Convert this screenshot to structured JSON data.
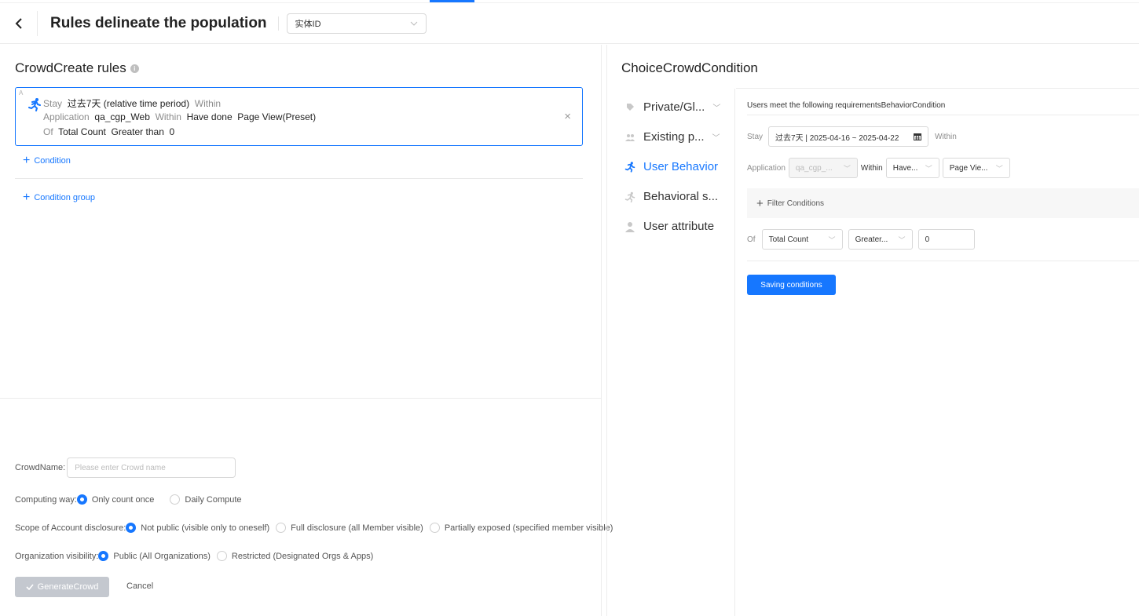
{
  "header": {
    "title": "Rules delineate the population",
    "entity_select": "实体ID"
  },
  "left": {
    "section_title": "CrowdCreate rules",
    "rule": {
      "corner_mark": "A",
      "line1_stay": "Stay",
      "line1_period": "过去7天 (relative time period)",
      "line1_within": "Within",
      "line2_application": "Application",
      "line2_app": "qa_cgp_Web",
      "line2_within": "Within",
      "line2_done": "Have done",
      "line2_event": "Page View(Preset)",
      "line3_of": "Of",
      "line3_metric": "Total Count",
      "line3_op": "Greater than",
      "line3_value": "0",
      "close": "×"
    },
    "add_condition": "Condition",
    "add_condition_group": "Condition group"
  },
  "footer": {
    "crowd_name_label": "CrowdName:",
    "crowd_name_placeholder": "Please enter Crowd name",
    "computing_label": "Computing way:",
    "computing_opt1": "Only count once",
    "computing_opt2": "Daily Compute",
    "scope_label": "Scope of Account disclosure:",
    "scope_opt1": "Not public (visible only to oneself)",
    "scope_opt2": "Full disclosure (all Member visible)",
    "scope_opt3": "Partially exposed (specified member visible)",
    "org_label": "Organization visibility:",
    "org_opt1": "Public (All Organizations)",
    "org_opt2": "Restricted (Designated Orgs & Apps)",
    "generate_label": "GenerateCrowd",
    "cancel_label": "Cancel"
  },
  "right": {
    "title": "ChoiceCrowdCondition",
    "categories": [
      {
        "label": "Private/Gl...",
        "icon": "tag-icon"
      },
      {
        "label": "Existing p...",
        "icon": "people-icon"
      },
      {
        "label": "User Behavior",
        "icon": "runner-icon"
      },
      {
        "label": "Behavioral s...",
        "icon": "sequence-icon"
      },
      {
        "label": "User attribute",
        "icon": "person-icon"
      }
    ],
    "requirement_text": "Users meet the following requirementsBehaviorCondition",
    "stay_label": "Stay",
    "date_range": "过去7天 | 2025-04-16 ~ 2025-04-22",
    "within_label": "Within",
    "application_label": "Application",
    "app_value": "qa_cgp_...",
    "within2_label": "Within",
    "have_value": "Have...",
    "event_value": "Page Vie...",
    "filter_label": "Filter Conditions",
    "of_label": "Of",
    "metric_value": "Total Count",
    "operator_value": "Greater...",
    "number_value": "0",
    "save_label": "Saving conditions"
  },
  "colors": {
    "accent": "#1677ff",
    "disabled_button": "#c4c8cf"
  }
}
